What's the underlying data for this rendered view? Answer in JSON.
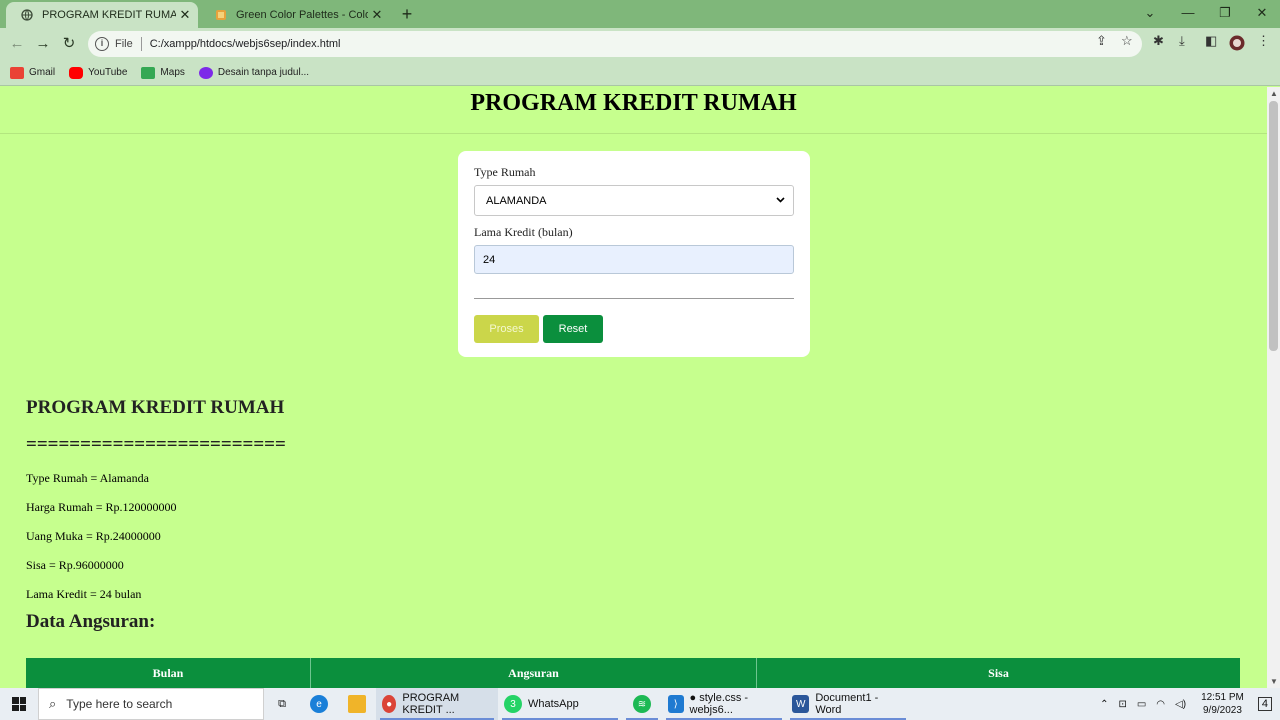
{
  "browser": {
    "tabs": [
      {
        "title": "PROGRAM KREDIT RUMAH",
        "active": true
      },
      {
        "title": "Green Color Palettes - Color Hun",
        "active": false
      }
    ],
    "new_tab": "+",
    "window_controls": {
      "collapse": "⌄",
      "minimize": "—",
      "maximize": "❐",
      "close": "✕"
    },
    "address": {
      "scheme": "File",
      "url": "C:/xampp/htdocs/webjs6sep/index.html"
    },
    "bookmarks": [
      {
        "label": "Gmail",
        "icon": "gmail-icon",
        "color": "#ea4335"
      },
      {
        "label": "YouTube",
        "icon": "youtube-icon",
        "color": "#ff0000"
      },
      {
        "label": "Maps",
        "icon": "maps-icon",
        "color": "#34a853"
      },
      {
        "label": "Desain tanpa judul...",
        "icon": "canva-icon",
        "color": "#7d2ae8"
      }
    ]
  },
  "page": {
    "header_title": "PROGRAM KREDIT RUMAH",
    "form": {
      "type_label": "Type Rumah",
      "type_value": "ALAMANDA",
      "duration_label": "Lama Kredit (bulan)",
      "duration_value": "24",
      "process_label": "Proses",
      "reset_label": "Reset"
    },
    "result": {
      "title": "PROGRAM KREDIT RUMAH",
      "separator": "========================",
      "lines": [
        "Type Rumah = Alamanda",
        "Harga Rumah = Rp.120000000",
        "Uang Muka = Rp.24000000",
        "Sisa = Rp.96000000",
        "Lama Kredit = 24 bulan"
      ],
      "installments_title": "Data Angsuran:",
      "table_headers": [
        "Bulan",
        "Angsuran",
        "Sisa"
      ]
    },
    "colors": {
      "background": "#c6ff8e",
      "table_header": "#0b8f3d",
      "process_button": "#cbd64a",
      "reset_button": "#0b8f3d"
    }
  },
  "taskbar": {
    "search_placeholder": "Type here to search",
    "apps": [
      {
        "label": "PROGRAM KREDIT ...",
        "icon": "chrome-icon"
      },
      {
        "label": "WhatsApp",
        "icon": "whatsapp-icon",
        "badge": "3"
      },
      {
        "label": "",
        "icon": "spotify-icon"
      },
      {
        "label": "● style.css - webjs6...",
        "icon": "vscode-icon"
      },
      {
        "label": "Document1 - Word",
        "icon": "word-icon"
      }
    ],
    "time": "12:51 PM",
    "date": "9/9/2023",
    "notification_count": "4"
  }
}
